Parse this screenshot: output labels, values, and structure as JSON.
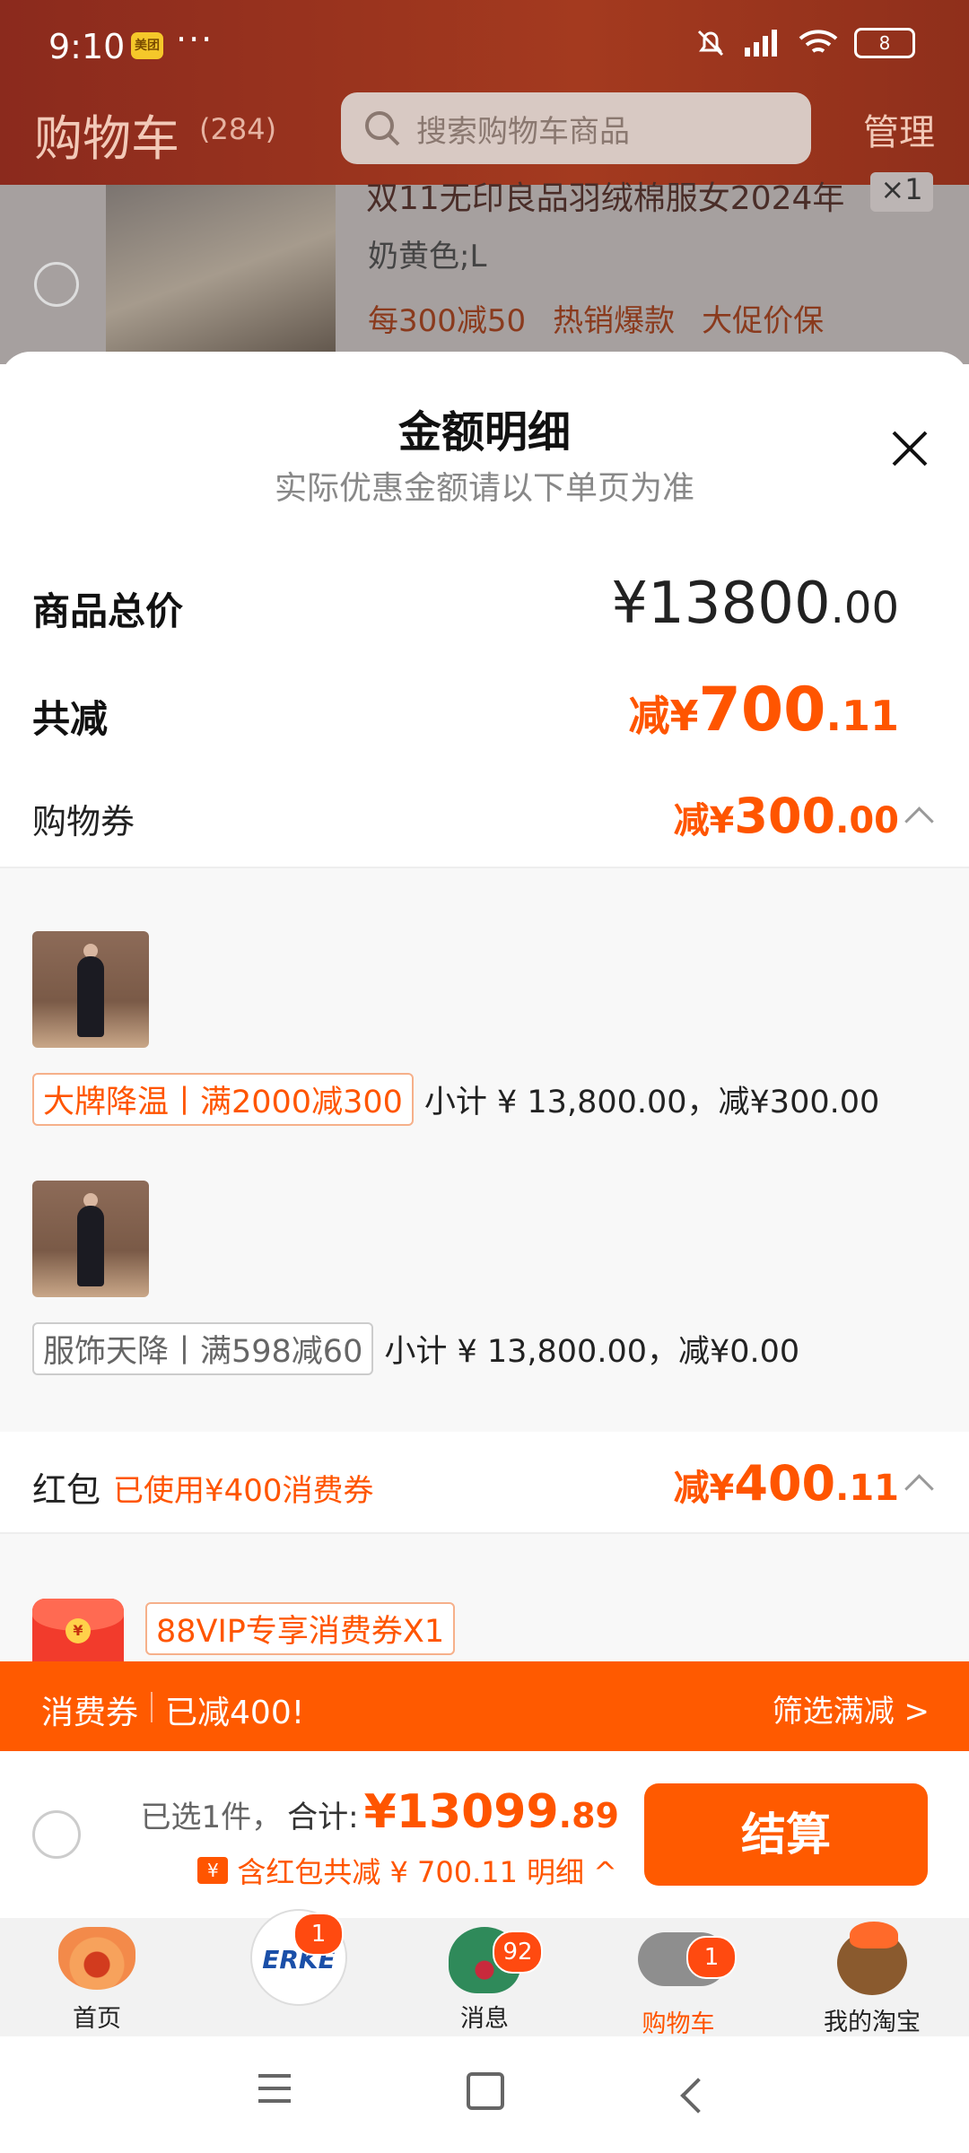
{
  "status": {
    "time": "9:10",
    "app_badge": "美团",
    "dots": "···",
    "battery": "8"
  },
  "header": {
    "title": "购物车",
    "count": "(284)",
    "search_placeholder": "搜索购物车商品",
    "manage": "管理"
  },
  "bg_item": {
    "name": "双11无印良品羽绒棉服女2024年",
    "qty": "×1",
    "spec": "奶黄色;L",
    "tags": [
      "每300减50",
      "热销爆款",
      "大促价保"
    ]
  },
  "sheet": {
    "title": "金额明细",
    "subtitle": "实际优惠金额请以下单页为准",
    "total": {
      "label": "商品总价",
      "currency": "¥",
      "int": "13800",
      "dec": ".00"
    },
    "discount": {
      "label": "共减",
      "prefix": "减¥",
      "int": "700",
      "dec": ".11"
    },
    "coupon": {
      "label": "购物券",
      "prefix": "减¥",
      "int": "300",
      "dec": ".00"
    },
    "promos": [
      {
        "tag": "大牌降温丨满2000减300",
        "detail": "小计 ¥ 13,800.00，减¥300.00"
      },
      {
        "tag": "服饰天降丨满598减60",
        "detail": "小计 ¥ 13,800.00，减¥0.00"
      }
    ],
    "redpack": {
      "label": "红包",
      "note": "已使用¥400消费券",
      "prefix": "减¥",
      "int": "400",
      "dec": ".11",
      "vip_tag": "88VIP专享消费券X1"
    }
  },
  "voucher_bar": {
    "left1": "消费券",
    "left2": "已减400!",
    "right": "筛选满减 >"
  },
  "checkout": {
    "selected": "已选1件，",
    "sum_label": "合计:",
    "price_int": "¥13099",
    "price_dec": ".89",
    "ticket": "¥",
    "saving": "含红包共减 ¥ 700.11",
    "detail": "明细 ^",
    "button": "结算"
  },
  "tabs": [
    {
      "label": "首页",
      "badge": ""
    },
    {
      "label": "",
      "badge": "1",
      "logo": "ERKE"
    },
    {
      "label": "消息",
      "badge": "92"
    },
    {
      "label": "购物车",
      "badge": "1"
    },
    {
      "label": "我的淘宝",
      "badge": ""
    }
  ],
  "colors": {
    "accent": "#ff5500",
    "header": "#9a3520",
    "bar": "#ff5a00"
  }
}
